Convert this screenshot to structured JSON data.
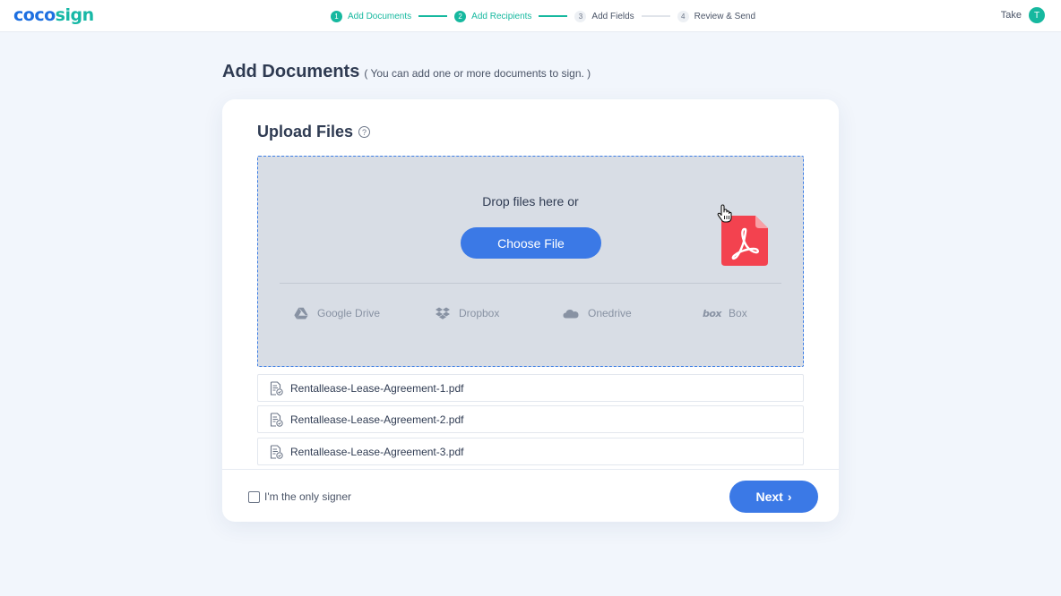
{
  "brand": {
    "part1": "coco",
    "part2": "sign"
  },
  "steps": [
    {
      "num": "1",
      "label": "Add Documents",
      "state": "done"
    },
    {
      "num": "2",
      "label": "Add Recipients",
      "state": "done"
    },
    {
      "num": "3",
      "label": "Add Fields",
      "state": "todo"
    },
    {
      "num": "4",
      "label": "Review & Send",
      "state": "todo"
    }
  ],
  "user": {
    "name": "Take",
    "initial": "T"
  },
  "page": {
    "title": "Add Documents",
    "subtitle": "( You can add one or more documents to sign. )"
  },
  "upload": {
    "title": "Upload Files",
    "help_icon": "question-circle-icon",
    "drop_text": "Drop files here or",
    "choose_label": "Choose File",
    "dragged_file_icon": "pdf-file-icon",
    "cursor_icon": "hand-cursor-icon",
    "providers": [
      {
        "label": "Google Drive",
        "icon": "google-drive-icon"
      },
      {
        "label": "Dropbox",
        "icon": "dropbox-icon"
      },
      {
        "label": "Onedrive",
        "icon": "onedrive-icon"
      },
      {
        "label": "Box",
        "icon": "box-icon",
        "logo_text": "box"
      }
    ]
  },
  "files": [
    {
      "name": "Rentallease-Lease-Agreement-1.pdf",
      "icon": "document-check-icon"
    },
    {
      "name": "Rentallease-Lease-Agreement-2.pdf",
      "icon": "document-check-icon"
    },
    {
      "name": "Rentallease-Lease-Agreement-3.pdf",
      "icon": "document-check-icon"
    }
  ],
  "footer": {
    "only_signer_label": "I'm the only signer",
    "only_signer_checked": false,
    "next_label": "Next",
    "next_icon": "chevron-right-icon"
  },
  "colors": {
    "accent_teal": "#16b89f",
    "primary_blue": "#3b79e6",
    "pdf_red": "#f3424f",
    "dropzone_bg": "#d8dde5"
  }
}
